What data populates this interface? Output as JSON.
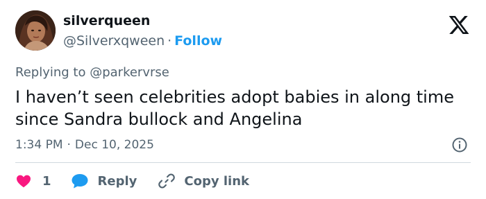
{
  "user": {
    "display_name": "silverqueen",
    "handle": "@Silverxqween",
    "separator": "·",
    "follow_label": "Follow"
  },
  "reply_context": {
    "prefix": "Replying to",
    "mention": "@parkervrse"
  },
  "tweet": {
    "text": "I haven’t seen celebrities adopt babies in along time since Sandra bullock and Angelina",
    "time": "1:34 PM",
    "separator": "·",
    "date": "Dec 10, 2025"
  },
  "actions": {
    "like_count": "1",
    "reply_label": "Reply",
    "copy_link_label": "Copy link"
  },
  "colors": {
    "accent": "#1d9bf0",
    "like": "#f91880",
    "reply_bubble": "#1d9bf0",
    "text_primary": "#0f1419",
    "text_secondary": "#536471",
    "divider": "#cfd9de"
  },
  "icons": [
    "x-logo-icon",
    "info-icon",
    "heart-icon",
    "reply-bubble-icon",
    "link-icon"
  ]
}
